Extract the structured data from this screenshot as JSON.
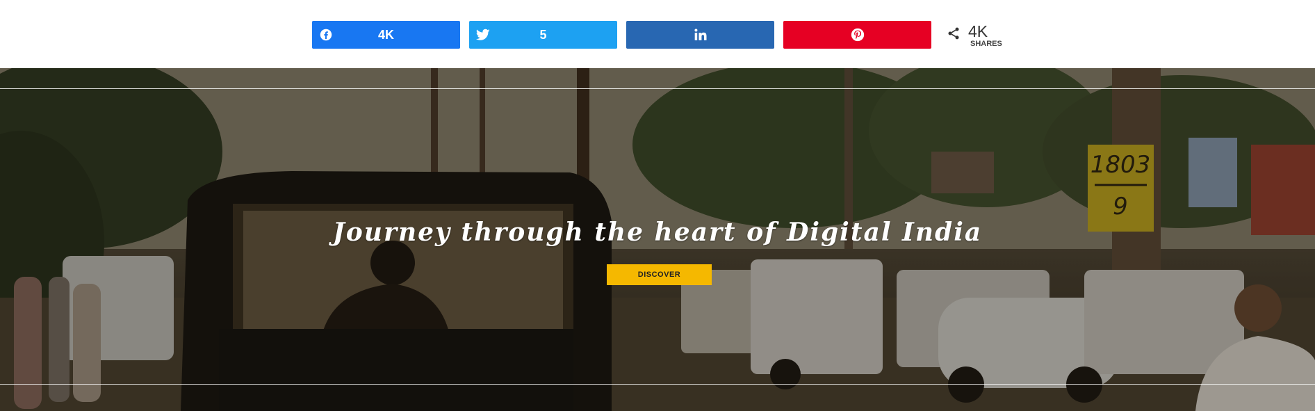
{
  "share": {
    "facebook": {
      "icon": "facebook-icon",
      "count": "4K",
      "color": "#1877f2"
    },
    "twitter": {
      "icon": "twitter-icon",
      "count": "5",
      "color": "#1da1f2"
    },
    "linkedin": {
      "icon": "linkedin-icon",
      "count": "",
      "color": "#2867b2"
    },
    "pinterest": {
      "icon": "pinterest-icon",
      "count": "",
      "color": "#e60023"
    },
    "total": {
      "icon": "share-icon",
      "count": "4K",
      "label": "SHARES"
    }
  },
  "hero": {
    "title": "Journey through the heart of Digital India",
    "button_label": "DISCOVER",
    "button_color": "#f5b800",
    "image": "street-scene-with-auto-rickshaw",
    "sign_text_top": "1803",
    "sign_text_bottom": "9"
  }
}
